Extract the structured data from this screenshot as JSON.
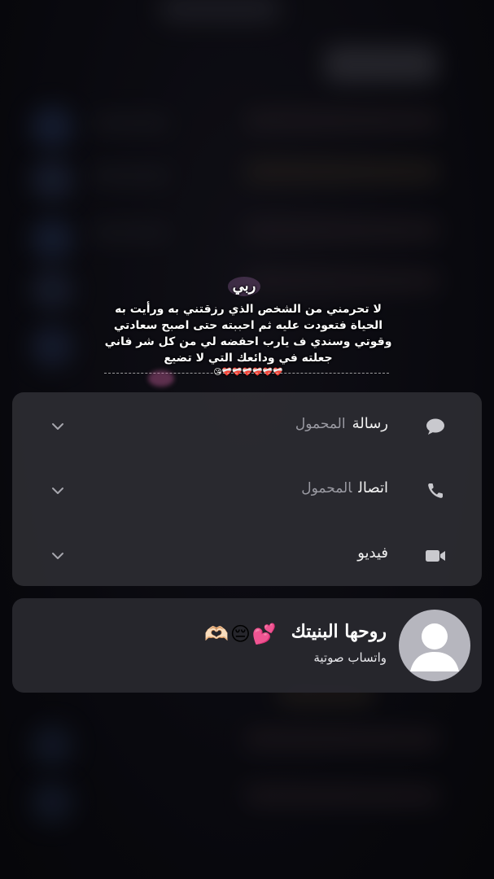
{
  "caption": {
    "title": "ربي",
    "body": "لا تحرمني من الشخص الذي رزقتني به ورأيت به الحياة فتعودت عليه ثم احببته حتى اصبح سعادتي وقوتي وسندي ف يارب احفضه لي من كل شر فاني جعلته في ودائعك التي لا تضيع",
    "hearts": "❤️‍🩹❤️‍🩹❤️‍🩹❤️‍🩹❤️‍🩹❤️‍🩹😘"
  },
  "menu": {
    "items": [
      {
        "label": "رسالة",
        "sub": "المحمول",
        "icon": "message-icon"
      },
      {
        "label": "اتصال",
        "sub": "المحمول",
        "icon": "phone-icon"
      },
      {
        "label": "فيديو",
        "sub": "",
        "icon": "video-icon"
      }
    ]
  },
  "contact": {
    "name": "روحها البنيتك",
    "emoji": "🫶🏻😔💕",
    "subtitle": "واتساب صوتية",
    "avatar_icon": "person-avatar-icon"
  },
  "colors": {
    "menu_bg": "#2c2c32",
    "secondary_text": "#9a9aa2",
    "avatar_bg": "#b6b6be"
  }
}
